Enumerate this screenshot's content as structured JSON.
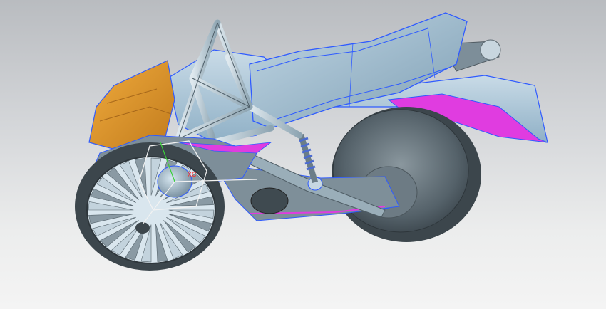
{
  "viewport": {
    "background_top": "#b9bcc0",
    "background_bottom": "#f4f4f4"
  },
  "model": {
    "colors": {
      "body_surface": "#a9c4d6",
      "metal": "#5e6b72",
      "frame": "#b8cad4",
      "wheel_dark": "#3c464c",
      "fairing_front": "#e39a2c",
      "highlight_surface": "#e03ce0",
      "edge_lines": "#2f5bff"
    },
    "icons": {
      "wcs": "coordinate-system-icon"
    }
  },
  "csys": {
    "axis_label": "XC"
  }
}
